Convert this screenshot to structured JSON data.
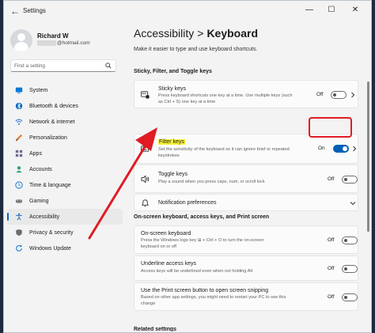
{
  "window": {
    "title": "Settings",
    "back_glyph": "←",
    "controls": {
      "minimize": "—",
      "maximize": "☐",
      "close": "✕"
    }
  },
  "user": {
    "name": "Richard W",
    "email_suffix": "@hotmail.com"
  },
  "search": {
    "placeholder": "Find a setting"
  },
  "nav": [
    {
      "label": "System",
      "icon": "monitor-icon",
      "color": "#0078d4"
    },
    {
      "label": "Bluetooth & devices",
      "icon": "bluetooth-icon",
      "color": "#0067c0"
    },
    {
      "label": "Network & internet",
      "icon": "network-icon",
      "color": "#3a7bd5"
    },
    {
      "label": "Personalization",
      "icon": "brush-icon",
      "color": "#e3813a"
    },
    {
      "label": "Apps",
      "icon": "apps-icon",
      "color": "#6b6b8f"
    },
    {
      "label": "Accounts",
      "icon": "person-icon",
      "color": "#2ea37a"
    },
    {
      "label": "Time & language",
      "icon": "clock-globe-icon",
      "color": "#1e7fd0"
    },
    {
      "label": "Gaming",
      "icon": "gamepad-icon",
      "color": "#707070"
    },
    {
      "label": "Accessibility",
      "icon": "accessibility-icon",
      "color": "#1d6fc2",
      "active": true
    },
    {
      "label": "Privacy & security",
      "icon": "shield-icon",
      "color": "#6d6d6d"
    },
    {
      "label": "Windows Update",
      "icon": "update-icon",
      "color": "#1e7fd0"
    }
  ],
  "main": {
    "breadcrumb_parent": "Accessibility",
    "breadcrumb_sep": ">",
    "breadcrumb_current": "Keyboard",
    "subtitle": "Make it easier to type and use keyboard shortcuts.",
    "section1": "Sticky, Filter, and Toggle keys",
    "section2": "On-screen keyboard, access keys, and Print screen",
    "section3_cut": "Related settings",
    "cards": {
      "sticky": {
        "title": "Sticky keys",
        "desc": "Press keyboard shortcuts one key at a time. Use multiple keys (such as Ctrl + S) one key at a time",
        "state": "Off",
        "toggle": "off"
      },
      "filter": {
        "title": "Filter keys",
        "desc": "Set the sensitivity of the keyboard so it can ignore brief or repeated keystrokes",
        "state": "On",
        "toggle": "on"
      },
      "toggle_keys": {
        "title": "Toggle keys",
        "desc": "Play a sound when you press caps, num, or scroll lock",
        "state": "Off",
        "toggle": "off"
      },
      "notifications": {
        "title": "Notification preferences"
      },
      "onscreen": {
        "title": "On-screen keyboard",
        "desc": "Press the Windows logo key ⊞ + Ctrl + O to turn the on-screen keyboard on or off",
        "state": "Off",
        "toggle": "off"
      },
      "underline": {
        "title": "Underline access keys",
        "desc": "Access keys will be underlined even when not holding Alt",
        "state": "Off",
        "toggle": "off"
      },
      "printscreen": {
        "title": "Use the Print screen button to open screen snipping",
        "desc": "Based on other app settings, you might need to restart your PC to see this change",
        "state": "Off",
        "toggle": "off"
      }
    }
  },
  "colors": {
    "accent": "#005fb8",
    "annotation_red": "#e01b24",
    "highlight_yellow": "#f6f23a"
  }
}
